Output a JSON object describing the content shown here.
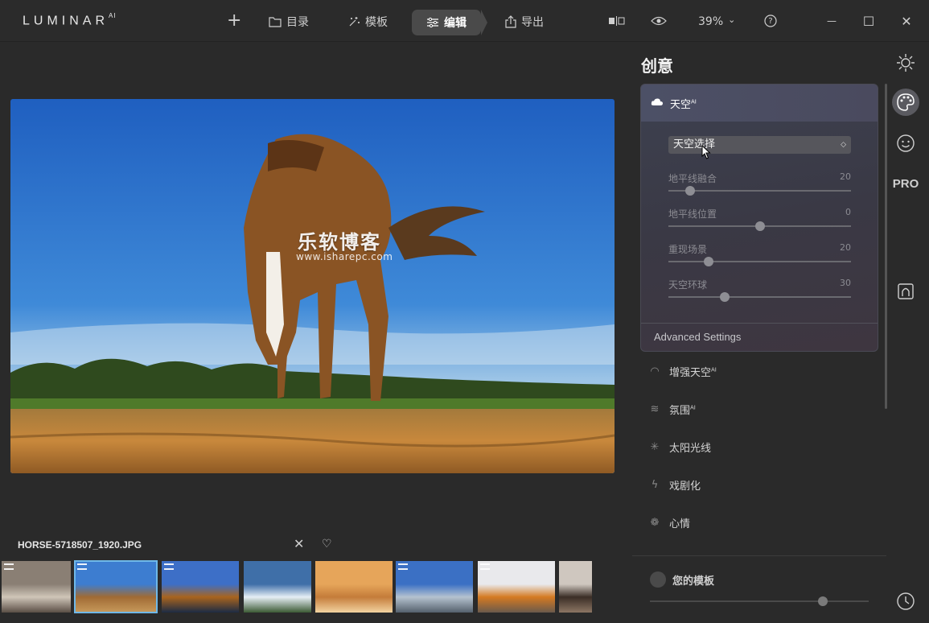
{
  "app": {
    "logo": "LUMINAR",
    "logo_sup": "AI"
  },
  "toolbar": {
    "add_label": "+",
    "catalog_label": "目录",
    "templates_label": "模板",
    "edit_label": "编辑",
    "export_label": "导出",
    "zoom_label": "39%",
    "zoom_caret": "⌄",
    "help_label": "?",
    "minimize_label": "—",
    "maximize_label": "☐",
    "close_label": "✕"
  },
  "photo": {
    "watermark_title": "乐软博客",
    "watermark_url": "www.isharepc.com"
  },
  "filmstrip": {
    "filename": "HORSE-5718507_1920.JPG",
    "close_label": "✕",
    "heart_label": "♡",
    "thumbs": [
      {
        "colors": [
          "#8a7f74",
          "#cfc5b8",
          "#5a4e45"
        ],
        "badge": true
      },
      {
        "colors": [
          "#3d7dd0",
          "#a06b34",
          "#c89a5c"
        ],
        "badge": true,
        "selected": true
      },
      {
        "colors": [
          "#3d6fc7",
          "#a8641e",
          "#1c2b44"
        ],
        "badge": true
      },
      {
        "colors": [
          "#3f6fa8",
          "#e6eef5",
          "#3c5a34"
        ],
        "badge": false
      },
      {
        "colors": [
          "#e6a55a",
          "#c47c3a",
          "#f3d3a0"
        ],
        "badge": false
      },
      {
        "colors": [
          "#3b70c4",
          "#b5c2cf",
          "#55606c"
        ],
        "badge": true
      },
      {
        "colors": [
          "#e9e9ec",
          "#d57a22",
          "#6a5a4c"
        ],
        "badge": true
      },
      {
        "colors": [
          "#cfc7bf",
          "#3b2e26",
          "#8c7664"
        ],
        "badge": false
      }
    ]
  },
  "panel": {
    "title": "创意",
    "sky": {
      "header": "天空",
      "header_sup": "AI",
      "select_value": "天空选择",
      "select_arrow": "⌃⌄",
      "sliders": [
        {
          "label": "地平线融合",
          "value": "20",
          "level": 0.12
        },
        {
          "label": "地平线位置",
          "value": "0",
          "level": 0.5
        },
        {
          "label": "重现场景",
          "value": "20",
          "level": 0.22
        },
        {
          "label": "天空环球",
          "value": "30",
          "level": 0.31
        }
      ],
      "advanced": "Advanced Settings"
    },
    "tools": [
      {
        "label": "增强天空",
        "sup": "AI",
        "icon": "◠"
      },
      {
        "label": "氛围",
        "sup": "AI",
        "icon": "≋"
      },
      {
        "label": "太阳光线",
        "sup": "",
        "icon": "✳"
      },
      {
        "label": "戏剧化",
        "sup": "",
        "icon": "ϟ"
      },
      {
        "label": "心情",
        "sup": "",
        "icon": "❁"
      }
    ],
    "templates_label": "您的模板",
    "templates_level": 0.79
  },
  "rail": {
    "pro_label": "PRO"
  }
}
